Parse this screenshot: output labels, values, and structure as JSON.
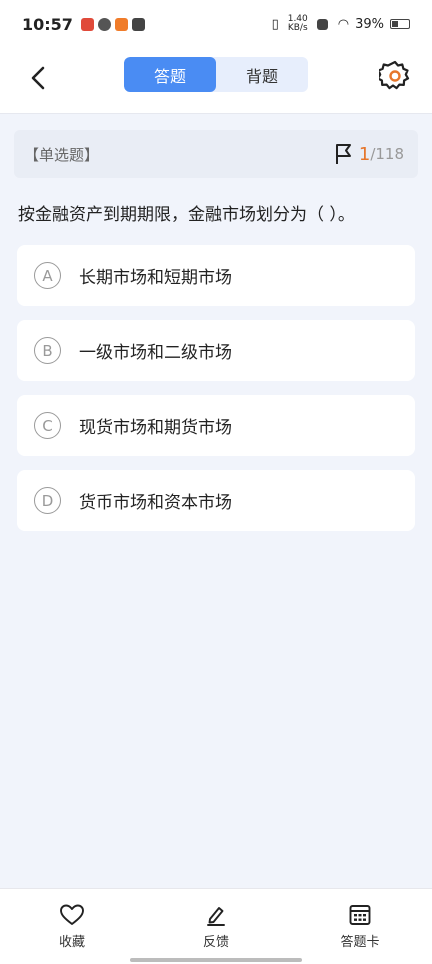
{
  "status_bar": {
    "time": "10:57",
    "net_speed": "1.40 KB/s",
    "battery": "39%",
    "icons": [
      "app-red-icon",
      "app-swirl-icon",
      "app-orange-icon",
      "mail-icon",
      "vibrate-icon",
      "sim-icon",
      "wifi-icon",
      "battery-icon"
    ]
  },
  "header": {
    "back_icon": "chevron-left-icon",
    "tabs": [
      {
        "label": "答题",
        "active": true
      },
      {
        "label": "背题",
        "active": false
      }
    ],
    "settings_icon": "gear-icon"
  },
  "question_header": {
    "type_label": "【单选题】",
    "flag_icon": "flag-icon",
    "current": "1",
    "total": "/118"
  },
  "question": {
    "text": "按金融资产到期期限，金融市场划分为（    ）。",
    "options": [
      {
        "letter": "A",
        "text": "长期市场和短期市场"
      },
      {
        "letter": "B",
        "text": "一级市场和二级市场"
      },
      {
        "letter": "C",
        "text": "现货市场和期货市场"
      },
      {
        "letter": "D",
        "text": "货币市场和资本市场"
      }
    ]
  },
  "bottom_bar": {
    "items": [
      {
        "label": "收藏",
        "icon": "heart-icon"
      },
      {
        "label": "反馈",
        "icon": "edit-icon"
      },
      {
        "label": "答题卡",
        "icon": "answer-card-icon"
      }
    ]
  },
  "colors": {
    "accent": "#4a8cf3",
    "accent_light": "#e7eefc",
    "counter": "#e6762b",
    "page_bg": "#f1f4fb"
  }
}
